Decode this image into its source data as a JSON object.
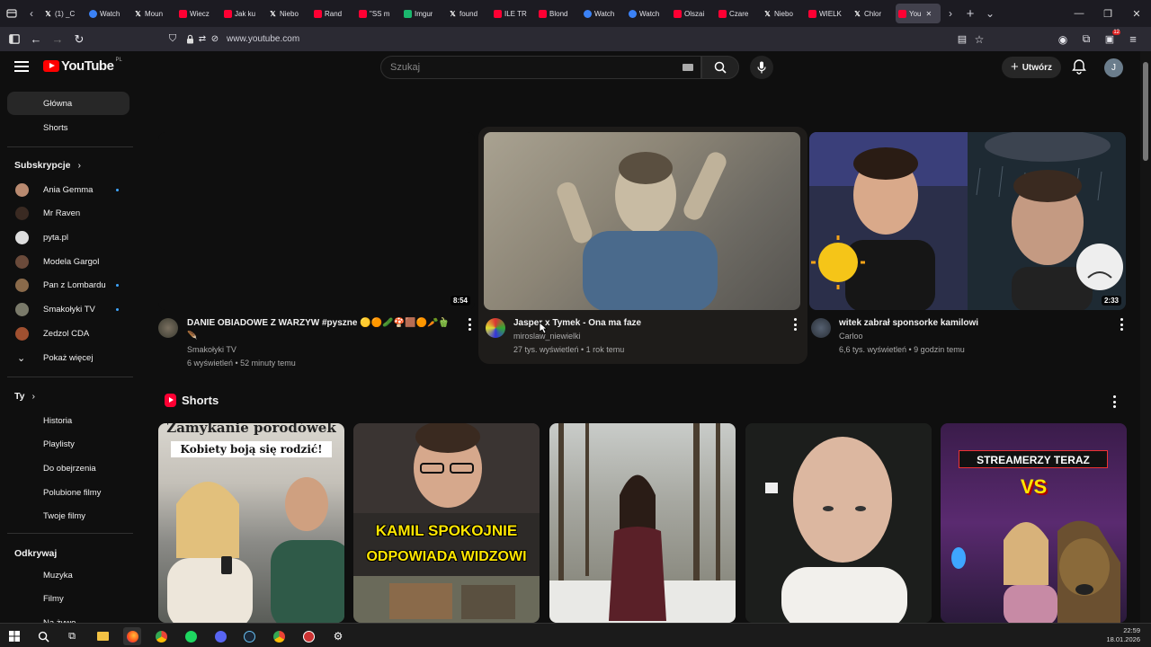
{
  "browser": {
    "tabs": [
      {
        "label": "(1) _C",
        "fav": "x",
        "color": "#000000"
      },
      {
        "label": "Watch",
        "fav": "circle",
        "color": "#3b82f6"
      },
      {
        "label": "Moun",
        "fav": "x",
        "color": "#000000"
      },
      {
        "label": "Wiecz",
        "fav": "yt",
        "color": "#ff0033"
      },
      {
        "label": "Jak ku",
        "fav": "yt",
        "color": "#ff0033"
      },
      {
        "label": "Niebo",
        "fav": "x",
        "color": "#000000"
      },
      {
        "label": "Rand",
        "fav": "yt",
        "color": "#ff0033"
      },
      {
        "label": "\"SS m",
        "fav": "yt",
        "color": "#ff0033"
      },
      {
        "label": "Imgur",
        "fav": "img",
        "color": "#1bb76e"
      },
      {
        "label": "found",
        "fav": "x",
        "color": "#000000"
      },
      {
        "label": "ILE TR",
        "fav": "yt",
        "color": "#ff0033"
      },
      {
        "label": "Blond",
        "fav": "yt",
        "color": "#ff0033"
      },
      {
        "label": "Watch",
        "fav": "circle",
        "color": "#3b82f6"
      },
      {
        "label": "Watch",
        "fav": "circle",
        "color": "#3b82f6"
      },
      {
        "label": "Olszai",
        "fav": "yt",
        "color": "#ff0033"
      },
      {
        "label": "Czare",
        "fav": "yt",
        "color": "#ff0033"
      },
      {
        "label": "Niebo",
        "fav": "x",
        "color": "#000000"
      },
      {
        "label": "WIELK",
        "fav": "yt",
        "color": "#ff0033"
      },
      {
        "label": "Chlor",
        "fav": "x",
        "color": "#000000"
      },
      {
        "label": "You",
        "fav": "yt",
        "color": "#ff0033",
        "active": true
      }
    ],
    "url": "www.youtube.com",
    "ext_badge": "12"
  },
  "yt": {
    "logo_word": "YouTube",
    "logo_country": "PL",
    "search_placeholder": "Szukaj",
    "create_label": "Utwórz",
    "avatar_letter": "J"
  },
  "sidebar": {
    "home": "Główna",
    "shorts": "Shorts",
    "subs_header": "Subskrypcje",
    "subs": [
      {
        "label": "Ania Gemma",
        "dot": true,
        "color": "#b98a70"
      },
      {
        "label": "Mr Raven",
        "dot": false,
        "color": "#3a2a22"
      },
      {
        "label": "pyta.pl",
        "dot": false,
        "color": "#dddddd"
      },
      {
        "label": "Modela Gargol",
        "dot": false,
        "color": "#6a4a3a"
      },
      {
        "label": "Pan z Lombardu",
        "dot": true,
        "color": "#8a6a4a"
      },
      {
        "label": "Smakołyki TV",
        "dot": true,
        "color": "#7a7a6a"
      },
      {
        "label": "Zedzol CDA",
        "dot": false,
        "color": "#a05030"
      }
    ],
    "show_more": "Pokaż więcej",
    "you_header": "Ty",
    "you_items": [
      "Historia",
      "Playlisty",
      "Do obejrzenia",
      "Polubione filmy",
      "Twoje filmy"
    ],
    "explore_header": "Odkrywaj",
    "explore_items": [
      "Muzyka",
      "Filmy",
      "Na żywo"
    ]
  },
  "videos": [
    {
      "title": "DANIE OBIADOWE Z WARZYW #pyszne 🟡🟠🥒🍄🟫🟠🥕🫑",
      "title2": "🪶",
      "channel": "Smakołyki TV",
      "meta": "6 wyświetleń • 52 minuty temu",
      "duration": "8:54"
    },
    {
      "title": "Jasper x Tymek - Ona ma faze",
      "channel": "miroslaw_niewielki",
      "meta": "27 tys. wyświetleń • 1 rok temu",
      "duration": ""
    },
    {
      "title": "witek zabrał sponsorke kamilowi",
      "channel": "Carloo",
      "meta": "6,6 tys. wyświetleń • 9 godzin temu",
      "duration": "2:33"
    }
  ],
  "shorts": {
    "header": "Shorts",
    "items": [
      {
        "line1": "Zamykanie porodówek",
        "line2": "Kobiety boją się rodzić!"
      },
      {
        "line1": "KAMIL SPOKOJNIE",
        "line2": "ODPOWIADA WIDZOWI"
      },
      {
        "line1": "",
        "line2": ""
      },
      {
        "line1": "",
        "line2": ""
      },
      {
        "line1": "STREAMERZY TERAZ",
        "line2": "VS"
      }
    ]
  },
  "taskbar": {
    "time": "22:59",
    "date": "18.01.2026"
  }
}
